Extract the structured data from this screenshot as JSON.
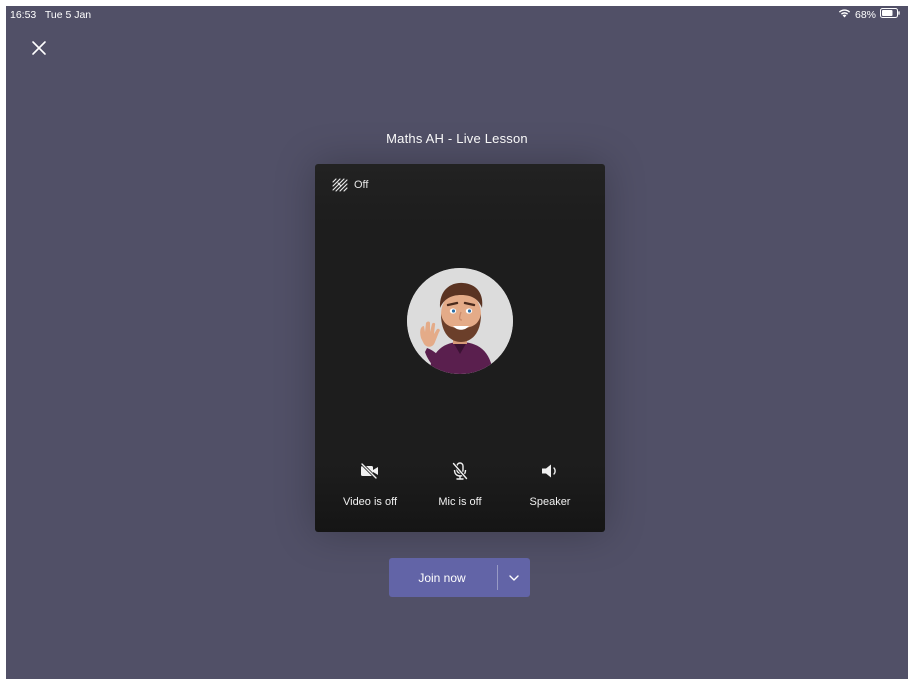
{
  "status_bar": {
    "time": "16:53",
    "date": "Tue 5 Jan",
    "battery": "68%"
  },
  "meeting": {
    "title": "Maths AH - Live Lesson"
  },
  "preview": {
    "background_effects_label": "Off",
    "controls": {
      "video_label": "Video is off",
      "mic_label": "Mic is off",
      "speaker_label": "Speaker"
    }
  },
  "join": {
    "label": "Join now"
  },
  "colors": {
    "screen_bg": "#515067",
    "accent": "#6264a7",
    "preview_bg": "#1d1d1d"
  },
  "icons": [
    "close-icon",
    "wifi-icon",
    "battery-icon",
    "background-effects-icon",
    "video-off-icon",
    "mic-off-icon",
    "speaker-icon",
    "chevron-down-icon"
  ]
}
